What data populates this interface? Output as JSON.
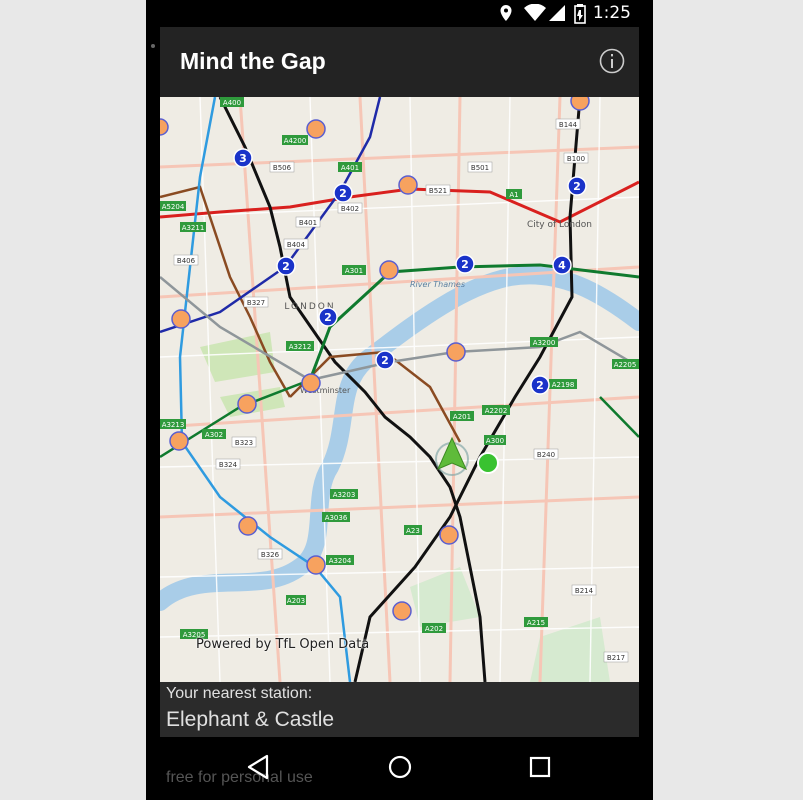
{
  "status_bar": {
    "time": "1:25",
    "icons": [
      "location-icon",
      "wifi-icon",
      "battery-icon"
    ]
  },
  "app": {
    "title": "Mind the Gap",
    "info_icon": "info-icon"
  },
  "map": {
    "attribution": "Powered by TfL Open Data",
    "colors": {
      "central_line": "#d9201e",
      "northern_line": "#111111",
      "district_line": "#0f7a2e",
      "piccadilly_line": "#1f2aa8",
      "bakerloo_line": "#8a4b22",
      "victoria_line": "#2f9be0",
      "jubilee_line": "#8f969a",
      "station_marker": "#f7a25f",
      "cluster_marker": "#1a33c9",
      "user_marker": "#39c230"
    },
    "clusters": [
      "2",
      "3",
      "2",
      "2",
      "2",
      "2",
      "4",
      "2",
      "2"
    ],
    "road_labels": [
      "A400",
      "A4200",
      "A401",
      "B506",
      "B402",
      "B521",
      "B501",
      "A1",
      "A5204",
      "B401",
      "B404",
      "B144",
      "B100",
      "A3211",
      "B406",
      "B327",
      "A301",
      "A3212",
      "A302",
      "A3213",
      "B323",
      "B324",
      "A201",
      "A2202",
      "A2198",
      "A3200",
      "A3036",
      "A3203",
      "A23",
      "B240",
      "A300",
      "B326",
      "A3204",
      "A202",
      "A215",
      "B214",
      "B217",
      "A3205",
      "A203",
      "A2205"
    ],
    "place_labels": [
      "City of London",
      "LONDON",
      "River Thames",
      "Westminster"
    ]
  },
  "nearest": {
    "label": "Your nearest station:",
    "station": "Elephant & Castle"
  },
  "footer": {
    "note": "free for personal use"
  }
}
